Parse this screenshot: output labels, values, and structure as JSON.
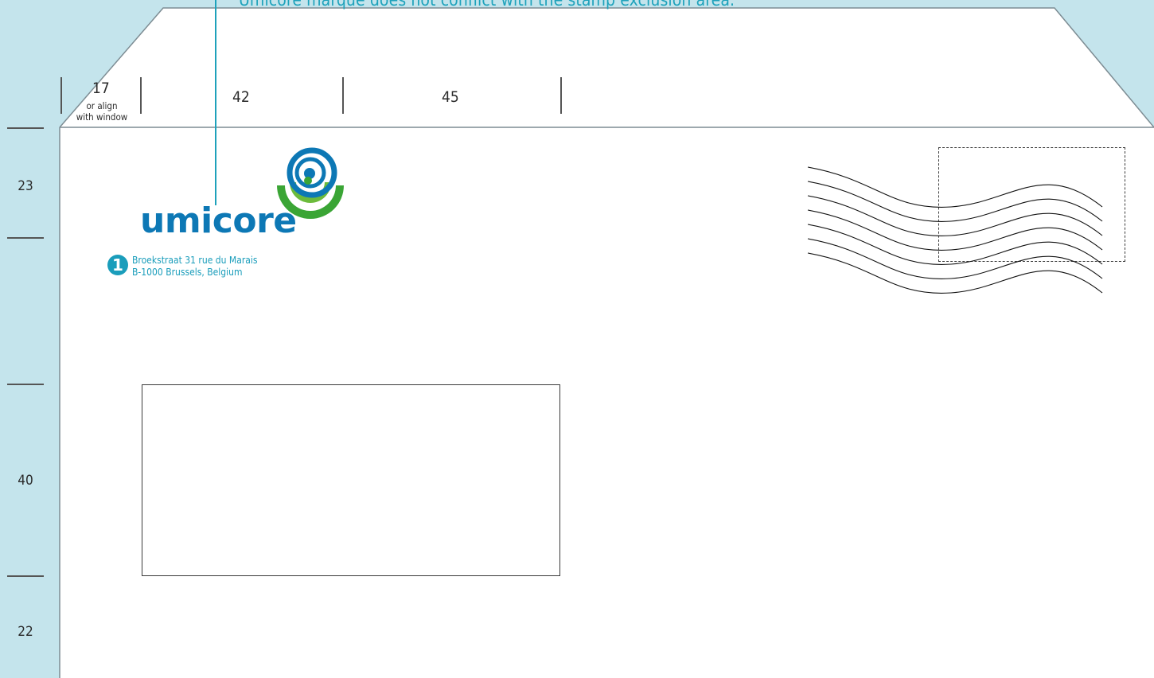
{
  "callout": {
    "text": "Umicore marque does not conflict with the stamp exclusion area."
  },
  "dimensions": {
    "top": {
      "first": "17",
      "first_note_line1": "or align",
      "first_note_line2": "with window",
      "second": "42",
      "third": "45"
    },
    "left": {
      "top_section": "23",
      "middle_section": "40",
      "bottom_section": "22"
    }
  },
  "logo": {
    "wordmark": "umicore",
    "colors": {
      "blue": "#0d78b5",
      "green": "#3aa535",
      "accent": "#1a9dbb"
    }
  },
  "return_address": {
    "badge_number": "1",
    "line1": "Broekstraat 31 rue du Marais",
    "line2": "B-1000 Brussels, Belgium"
  },
  "colors": {
    "background": "#c4e4ec",
    "callout": "#1ea2bb",
    "envelope": "#ffffff"
  }
}
